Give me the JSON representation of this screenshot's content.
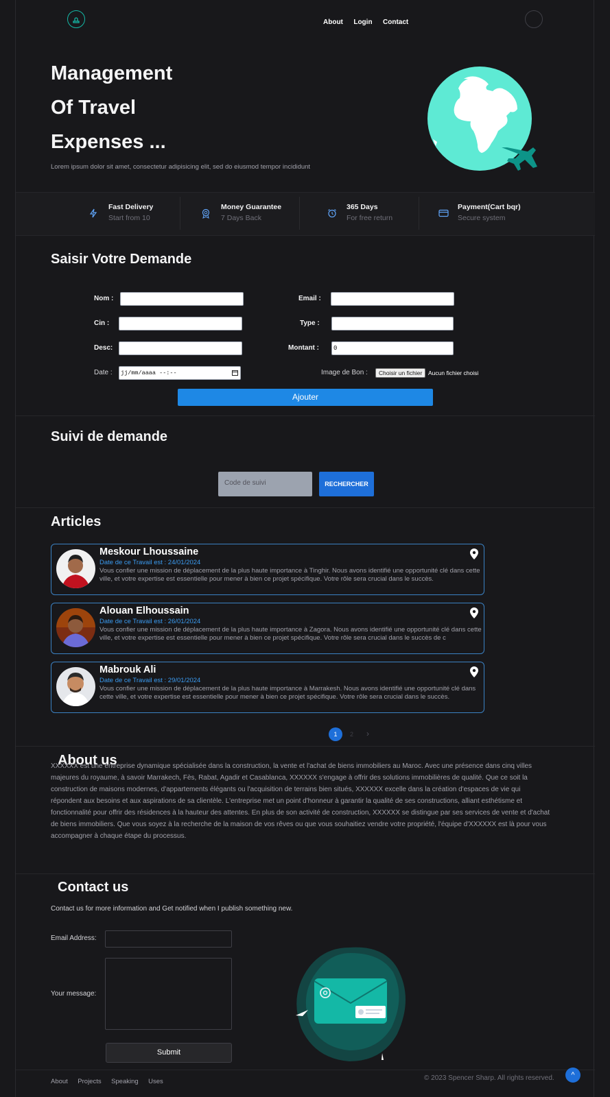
{
  "nav": {
    "links": [
      "About",
      "Login",
      "Contact"
    ]
  },
  "hero": {
    "title_lines": [
      "Management",
      "Of Travel",
      "Expenses ..."
    ],
    "subtitle": "Lorem ipsum dolor sit amet, consectetur adipisicing elit, sed do eiusmod tempor incididunt"
  },
  "stats": [
    {
      "icon": "bolt-icon",
      "title": "Fast Delivery",
      "sub": "Start from 10"
    },
    {
      "icon": "award-icon",
      "title": "Money Guarantee",
      "sub": "7 Days Back"
    },
    {
      "icon": "alarm-clock-icon",
      "title": "365 Days",
      "sub": "For free return"
    },
    {
      "icon": "credit-card-icon",
      "title": "Payment(Cart bqr)",
      "sub": "Secure system"
    }
  ],
  "request_form": {
    "heading": "Saisir Votre Demande",
    "nom_label": "Nom :",
    "email_label": "Email :",
    "cin_label": "Cin :",
    "type_label": "Type :",
    "desc_label": "Desc:",
    "montant_label": "Montant :",
    "montant_value": "0",
    "date_label": "Date :",
    "date_placeholder": "jj/mm/aaaa --:--",
    "image_label": "Image de Bon :",
    "file_button": "Choisir un fichier",
    "file_status": "Aucun fichier choisi",
    "submit": "Ajouter"
  },
  "tracking": {
    "heading": "Suivi de demande",
    "placeholder": "Code de suivi",
    "button": "RECHERCHER"
  },
  "articles": {
    "heading": "Articles",
    "items": [
      {
        "name": "Meskour Lhoussaine",
        "date": "Date de ce Travail est : 24/01/2024",
        "desc": "Vous confier une mission de déplacement de la plus haute importance à Tinghir. Nous avons identifié une opportunité clé dans cette ville, et votre expertise est essentielle pour mener à bien ce projet spécifique. Votre rôle sera crucial dans le succès."
      },
      {
        "name": "Alouan Elhoussain",
        "date": "Date de ce Travail est : 26/01/2024",
        "desc": "Vous confier une mission de déplacement de la plus haute importance à Zagora. Nous avons identifié une opportunité clé dans cette ville, et votre expertise est essentielle pour mener à bien ce projet spécifique. Votre rôle sera crucial dans le succès de c"
      },
      {
        "name": "Mabrouk Ali",
        "date": "Date de ce Travail est : 29/01/2024",
        "desc": "Vous confier une mission de déplacement de la plus haute importance à Marrakesh. Nous avons identifié une opportunité clé dans cette ville, et votre expertise est essentielle pour mener à bien ce projet spécifique. Votre rôle sera crucial dans le succès."
      }
    ],
    "pagination": {
      "current": "1",
      "next_page": "2",
      "next_arrow": "›"
    }
  },
  "about": {
    "heading": "About us",
    "text": "XXXXXX est une entreprise dynamique spécialisée dans la construction, la vente et l'achat de biens immobiliers au Maroc. Avec une présence dans cinq villes majeures du royaume, à savoir Marrakech, Fès, Rabat, Agadir et Casablanca, XXXXXX s'engage à offrir des solutions immobilières de qualité. Que ce soit la construction de maisons modernes, d'appartements élégants ou l'acquisition de terrains bien situés, XXXXXX excelle dans la création d'espaces de vie qui répondent aux besoins et aux aspirations de sa clientèle. L'entreprise met un point d'honneur à garantir la qualité de ses constructions, alliant esthétisme et fonctionnalité pour offrir des résidences à la hauteur des attentes. En plus de son activité de construction, XXXXXX se distingue par ses services de vente et d'achat de biens immobiliers. Que vous soyez à la recherche de la maison de vos rêves ou que vous souhaitiez vendre votre propriété, l'équipe d'XXXXXX est là pour vous accompagner à chaque étape du processus."
  },
  "contact": {
    "heading": "Contact us",
    "intro": "Contact us for more information and Get notified when I publish something new.",
    "email_label": "Email Address:",
    "message_label": "Your message:",
    "submit": "Submit"
  },
  "footer": {
    "links": [
      "About",
      "Projects",
      "Speaking",
      "Uses"
    ],
    "copyright": "© 2023 Spencer Sharp. All rights reserved.",
    "to_top": "^"
  },
  "colors": {
    "accent": "#1e88e5",
    "teal": "#14b8a6",
    "globe": "#5eead4",
    "background": "#18181b"
  }
}
